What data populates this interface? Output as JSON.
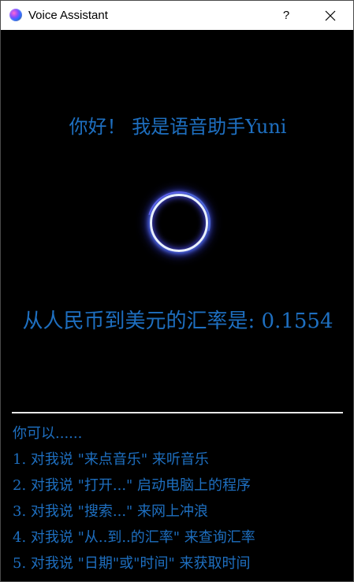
{
  "window": {
    "title": "Voice Assistant",
    "help_label": "?",
    "close_icon": "close-icon",
    "app_icon": "voice-assistant-orb-icon"
  },
  "main": {
    "greeting": "你好！ 我是语音助手Yuni",
    "orb_icon": "listening-orb-icon",
    "result": "从人民币到美元的汇率是: 0.1554"
  },
  "tips": {
    "heading": "你可以......",
    "items": [
      "1. 对我说 \"来点音乐\" 来听音乐",
      "2. 对我说 \"打开...\" 启动电脑上的程序",
      "3. 对我说 \"搜索...\" 来网上冲浪",
      "4. 对我说 \"从..到..的汇率\" 来查询汇率",
      "5. 对我说 \"日期\"或\"时间\" 来获取时间"
    ]
  },
  "colors": {
    "background": "#000000",
    "accent_text": "#1e6fc0",
    "divider": "#e8e8e8",
    "titlebar": "#ffffff"
  }
}
